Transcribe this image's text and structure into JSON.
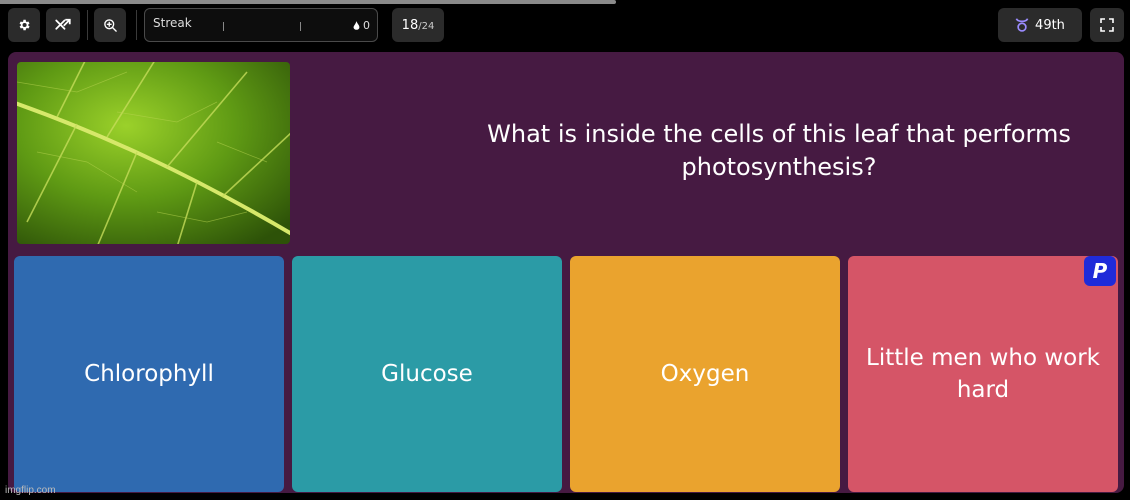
{
  "toolbar": {
    "settings_icon": "gear-icon",
    "power_up_icon": "shuffle-icon",
    "zoom_icon": "zoom-in-icon",
    "streak_label": "Streak",
    "streak_count": "0",
    "question_current": "18",
    "question_total": "/24",
    "rank": "49th",
    "rank_icon": "taurus-icon",
    "fullscreen_icon": "fullscreen-icon"
  },
  "quiz": {
    "question": "What is inside the cells of this leaf that performs photosynthesis?",
    "image": "leaf-closeup",
    "options": [
      {
        "label": "Chlorophyll",
        "color": "#2f6ab0"
      },
      {
        "label": "Glucose",
        "color": "#2b9ba6"
      },
      {
        "label": "Oxygen",
        "color": "#eaa32e"
      },
      {
        "label": "Little men who work hard",
        "color": "#d55567"
      }
    ],
    "badge": "P"
  },
  "colors": {
    "background": "#000000",
    "panel": "#461a42",
    "toolbar_button": "#2b2b2b",
    "badge": "#1f2bd9"
  },
  "watermark": "imgflip.com"
}
